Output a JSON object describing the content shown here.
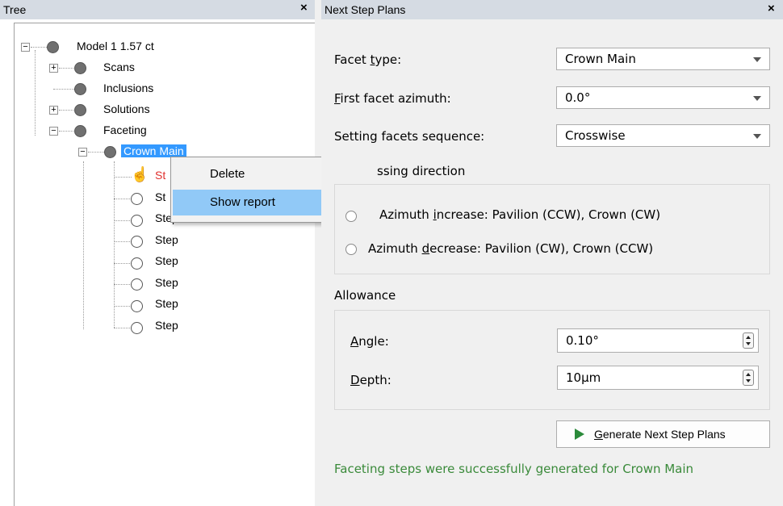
{
  "tree": {
    "title": "Tree",
    "close": "×",
    "root": "Model 1 1.57 ct",
    "children": {
      "scans": "Scans",
      "inclusions": "Inclusions",
      "solutions": "Solutions",
      "faceting": "Faceting",
      "crown_main": "Crown Main"
    },
    "steps": [
      "St",
      "St",
      "Step",
      "Step",
      "Step",
      "Step",
      "Step",
      "Step"
    ],
    "expand_plus": "+",
    "expand_minus": "−"
  },
  "context_menu": {
    "items": [
      "Delete",
      "Show report"
    ]
  },
  "panel": {
    "title": "Next Step Plans",
    "close": "×",
    "facet_type": {
      "label_pre": "Facet ",
      "label_u": "t",
      "label_post": "ype:",
      "value": "Crown Main"
    },
    "first_azimuth": {
      "label_u": "F",
      "label_post": "irst facet azimuth:",
      "value": "0.0°"
    },
    "sequence": {
      "label": "Setting facets sequence:",
      "value": "Crosswise"
    },
    "direction": {
      "title": "ssing direction",
      "opt1_pre": "Azimuth ",
      "opt1_u": "i",
      "opt1_post": "ncrease: Pavilion (CCW), Crown (CW)",
      "opt2_pre": "Azimuth ",
      "opt2_u": "d",
      "opt2_post": "ecrease: Pavilion (CW), Crown (CCW)"
    },
    "allowance": {
      "title": "Allowance",
      "angle_u": "A",
      "angle_post": "ngle:",
      "angle_value": "0.10°",
      "depth_u": "D",
      "depth_post": "epth:",
      "depth_value": "10µm"
    },
    "generate_u": "G",
    "generate_post": "enerate Next Step Plans",
    "status": "Faceting steps were successfully generated for Crown Main"
  }
}
